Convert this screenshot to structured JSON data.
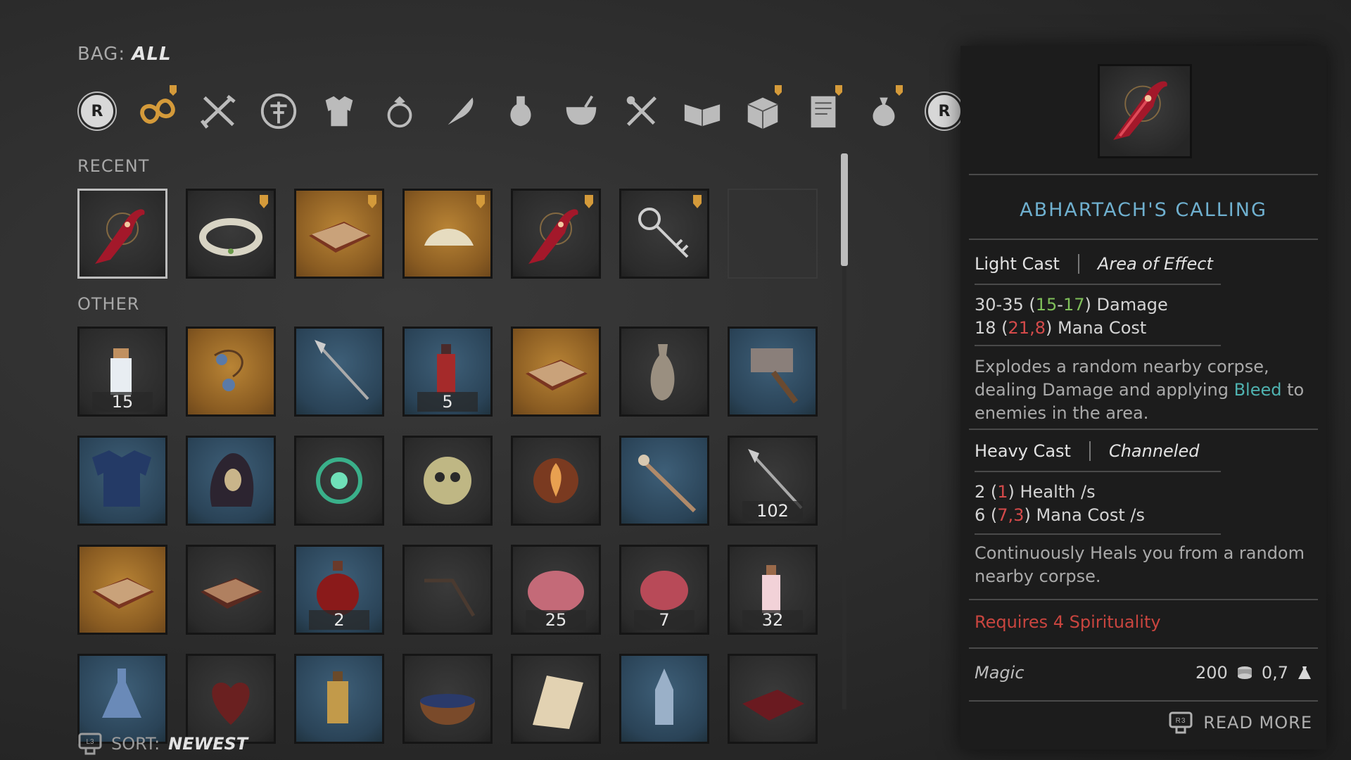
{
  "bag": {
    "label": "BAG:",
    "value": "ALL"
  },
  "categories": [
    {
      "icon": "r-button-left-icon"
    },
    {
      "icon": "infinity-all-icon",
      "selected": true,
      "pinned": true
    },
    {
      "icon": "crossed-weapons-icon"
    },
    {
      "icon": "shield-emblem-icon"
    },
    {
      "icon": "armor-chest-icon"
    },
    {
      "icon": "ring-icon"
    },
    {
      "icon": "feather-quill-icon"
    },
    {
      "icon": "potion-icon"
    },
    {
      "icon": "bowl-icon"
    },
    {
      "icon": "tools-icon"
    },
    {
      "icon": "open-book-icon"
    },
    {
      "icon": "crate-icon",
      "pinned": true
    },
    {
      "icon": "scroll-document-icon",
      "pinned": true
    },
    {
      "icon": "sack-icon",
      "pinned": true
    },
    {
      "icon": "r-button-right-icon"
    }
  ],
  "sections": {
    "recent": "RECENT",
    "other": "OTHER"
  },
  "recent_items": [
    {
      "name": "spell-rune-crimson",
      "bg": "dark",
      "selected": true
    },
    {
      "name": "jeweled-circlet",
      "bg": "dark",
      "pinned": true
    },
    {
      "name": "tome-book",
      "bg": "amber",
      "pinned": true
    },
    {
      "name": "pile-of-salt",
      "bg": "amber",
      "pinned": true
    },
    {
      "name": "spell-rune-crimson",
      "bg": "dark",
      "pinned": true
    },
    {
      "name": "iron-key",
      "bg": "dark",
      "pinned": true
    },
    {
      "name": "empty",
      "bg": "empty"
    }
  ],
  "other_items": [
    {
      "name": "milk-bottle",
      "bg": "dark",
      "count": "15"
    },
    {
      "name": "bead-necklace",
      "bg": "amber"
    },
    {
      "name": "spear",
      "bg": "blue"
    },
    {
      "name": "red-vial",
      "bg": "blue",
      "count": "5"
    },
    {
      "name": "tome-book",
      "bg": "amber"
    },
    {
      "name": "clay-jug",
      "bg": "dark"
    },
    {
      "name": "war-hammer",
      "bg": "blue"
    },
    {
      "name": "chest-armor",
      "bg": "blue"
    },
    {
      "name": "hooded-cowl",
      "bg": "blue"
    },
    {
      "name": "green-vortex-spell",
      "bg": "dark"
    },
    {
      "name": "skull-orb-spell",
      "bg": "dark"
    },
    {
      "name": "fire-orb-spell",
      "bg": "dark"
    },
    {
      "name": "bone-staff",
      "bg": "blue"
    },
    {
      "name": "spear",
      "bg": "dark",
      "count": "102"
    },
    {
      "name": "tome-book",
      "bg": "amber"
    },
    {
      "name": "brown-book",
      "bg": "dark"
    },
    {
      "name": "red-potion",
      "bg": "blue",
      "count": "2"
    },
    {
      "name": "hand-drill",
      "bg": "dark"
    },
    {
      "name": "raw-meat",
      "bg": "dark",
      "count": "25"
    },
    {
      "name": "brain",
      "bg": "dark",
      "count": "7"
    },
    {
      "name": "pink-bottle",
      "bg": "dark",
      "count": "32"
    },
    {
      "name": "blue-flask",
      "bg": "blue"
    },
    {
      "name": "heart",
      "bg": "dark"
    },
    {
      "name": "amber-bottle",
      "bg": "blue"
    },
    {
      "name": "mortar-bowl",
      "bg": "dark"
    },
    {
      "name": "parchment",
      "bg": "dark"
    },
    {
      "name": "ornate-lantern",
      "bg": "blue"
    },
    {
      "name": "red-tome",
      "bg": "dark"
    }
  ],
  "sort": {
    "label": "SORT:",
    "value": "NEWEST"
  },
  "detail": {
    "title": "ABHARTACH'S CALLING",
    "light_cast": {
      "label": "Light Cast",
      "modifier": "Area of Effect"
    },
    "light_stats": {
      "damage": {
        "base": "30-35 (",
        "low": "15",
        "dash": "-",
        "high": "17",
        "close": ")",
        "suffix": " Damage"
      },
      "mana": {
        "base": "18 (",
        "val": "21,8",
        "close": ")",
        "suffix": " Mana Cost"
      }
    },
    "light_desc": {
      "pre": "Explodes a random nearby corpse, dealing Damage and applying ",
      "keyword": "Bleed",
      "post": " to enemies in the area."
    },
    "heavy_cast": {
      "label": "Heavy Cast",
      "modifier": "Channeled"
    },
    "heavy_stats": {
      "health": {
        "base": "2 (",
        "val": "1",
        "close": ")",
        "suffix": " Health /s"
      },
      "mana": {
        "base": "6 (",
        "val": "7,3",
        "close": ")",
        "suffix": " Mana Cost /s"
      }
    },
    "heavy_desc": "Continuously Heals you from a random nearby corpse.",
    "requires": "Requires 4 Spirituality",
    "school": "Magic",
    "value": "200",
    "weight": "0,7",
    "read_more": "READ MORE"
  },
  "colors": {
    "title": "#6fb0cf",
    "bonus": "#7fbf5a",
    "penalty": "#d44a4a",
    "keyword": "#4fb2b0",
    "requires": "#c9453f"
  }
}
